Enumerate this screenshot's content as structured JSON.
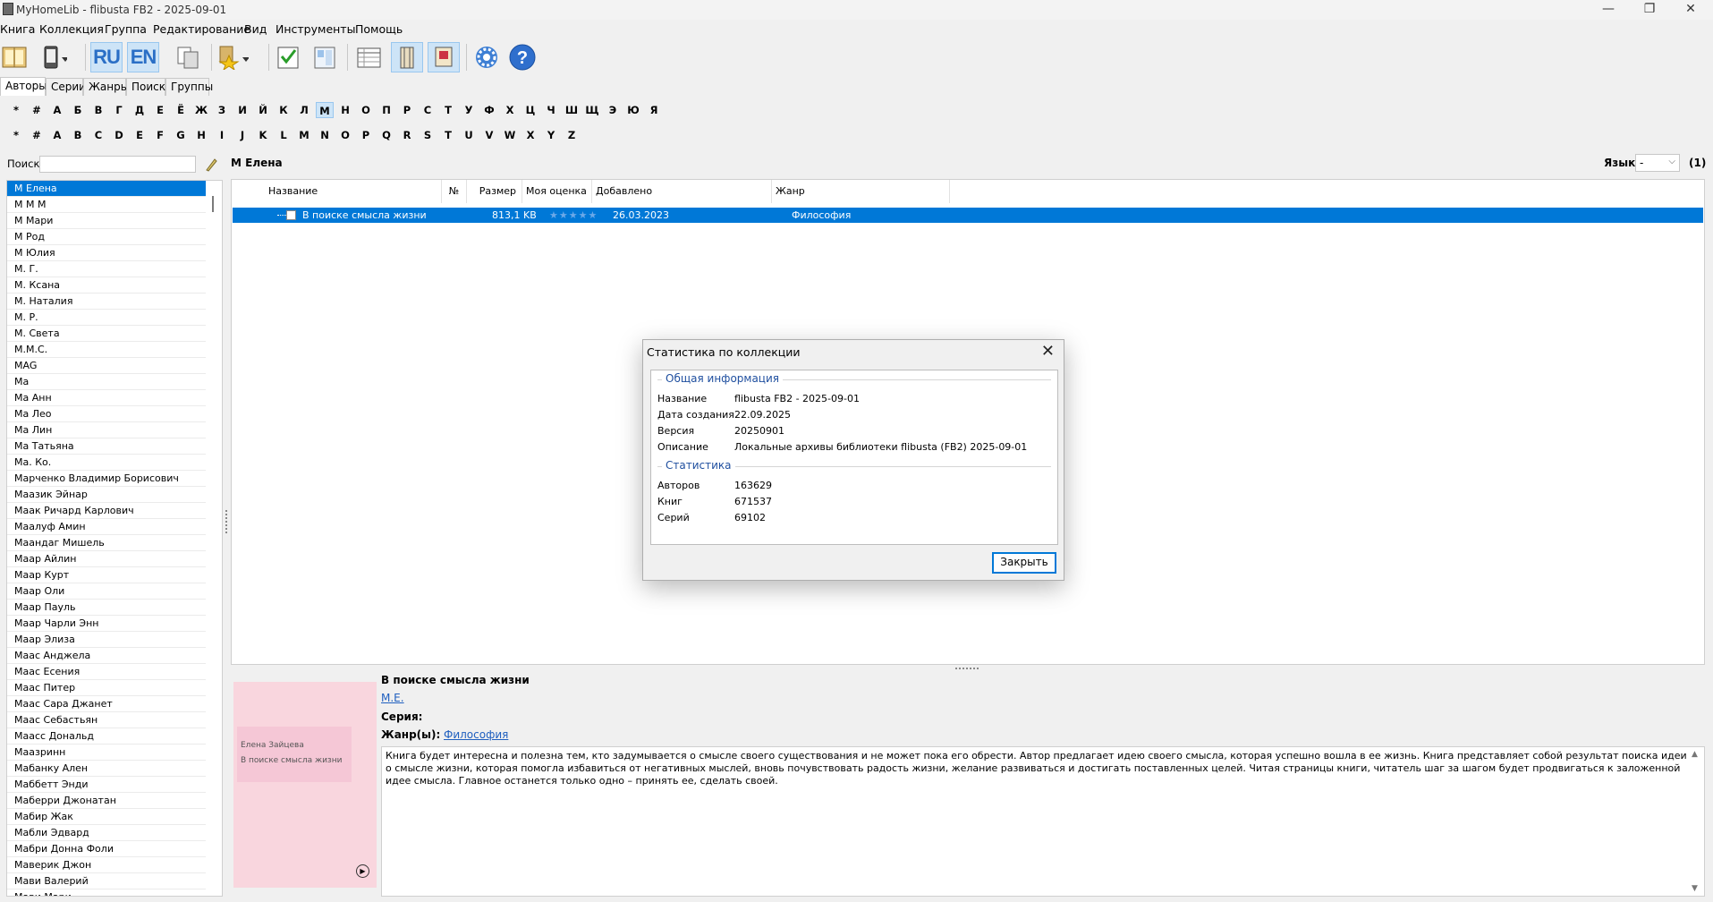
{
  "window": {
    "title": "MyHomeLib - flibusta FB2 - 2025-09-01",
    "minimize": "—",
    "maximize": "❐",
    "close": "✕"
  },
  "menu": [
    "Книга",
    "Коллекция",
    "Группа",
    "Редактирование",
    "Вид",
    "Инструменты",
    "Помощь"
  ],
  "toolbar": {
    "ru": "RU",
    "en": "EN",
    "help": "?"
  },
  "tabs": [
    "Авторы",
    "Серии",
    "Жанры",
    "Поиск",
    "Группы"
  ],
  "alphabet_ru": [
    "*",
    "#",
    "А",
    "Б",
    "В",
    "Г",
    "Д",
    "Е",
    "Ё",
    "Ж",
    "З",
    "И",
    "Й",
    "К",
    "Л",
    "М",
    "Н",
    "О",
    "П",
    "Р",
    "С",
    "Т",
    "У",
    "Ф",
    "Х",
    "Ц",
    "Ч",
    "Ш",
    "Щ",
    "Э",
    "Ю",
    "Я"
  ],
  "alphabet_en": [
    "*",
    "#",
    "A",
    "B",
    "C",
    "D",
    "E",
    "F",
    "G",
    "H",
    "I",
    "J",
    "K",
    "L",
    "M",
    "N",
    "O",
    "P",
    "Q",
    "R",
    "S",
    "T",
    "U",
    "V",
    "W",
    "X",
    "Y",
    "Z"
  ],
  "search": {
    "label": "Поиск",
    "value": ""
  },
  "author_heading": "М Елена",
  "language": {
    "label": "Язык",
    "value": "-",
    "count": "(1)"
  },
  "authors": [
    "М Елена",
    "М М М",
    "М Мари",
    "М Род",
    "М Юлия",
    "М. Г.",
    "М. Ксана",
    "М. Наталия",
    "М. Р.",
    "М. Света",
    "М.М.С.",
    "MAG",
    "Ма",
    "Ма Анн",
    "Ма Лео",
    "Ма Лин",
    "Ма Татьяна",
    "Ма. Ко.",
    "Марченко Владимир Борисович",
    "Маазик Эйнар",
    "Маак Ричард Карлович",
    "Маалуф Амин",
    "Маандаг Мишель",
    "Маар Айлин",
    "Маар Курт",
    "Маар Оли",
    "Маар Пауль",
    "Маар Чарли Энн",
    "Маар Элиза",
    "Маас Анджела",
    "Маас Есения",
    "Маас Питер",
    "Маас Сара Джанет",
    "Маас Себастьян",
    "Маасс Дональд",
    "Маазринн",
    "Мабанку Ален",
    "Маббетт Энди",
    "Маберри Джонатан",
    "Мабир Жак",
    "Мабли Эдвард",
    "Мабри Донна Фоли",
    "Маверик Джон",
    "Мави Валерий",
    "Мави Мари"
  ],
  "table": {
    "columns": [
      "Название",
      "№",
      "Размер",
      "Моя оценка",
      "Добавлено",
      "Жанр"
    ],
    "rows": [
      {
        "title": "В поиске смысла жизни",
        "num": "",
        "size": "813,1 KB",
        "rating": "★★★★★",
        "added": "26.03.2023",
        "genre": "Философия"
      }
    ]
  },
  "details": {
    "title": "В поиске смысла жизни",
    "author": "М.Е.",
    "series_label": "Серия:",
    "genre_label": "Жанр(ы):",
    "genre": "Философия",
    "cover_author": "Елена Зайцева",
    "cover_title": "В поиске смысла жизни",
    "annotation": "Книга будет интересна и полезна тем, кто задумывается о смысле своего существования и не может пока его обрести. Автор предлагает идею своего смысла, которая успешно вошла в ее жизнь. Книга представляет собой результат поиска идеи о смысле жизни, которая помогла избавиться от негативных мыслей, вновь почувствовать радость жизни, желание развиваться и достигать поставленных целей. Читая страницы книги, читатель шаг за шагом будет продвигаться к заложенной идее смысла. Главное останется только одно – принять ее, сделать своей."
  },
  "dialog": {
    "title": "Статистика по коллекции",
    "general_label": "Общая информация",
    "general": [
      {
        "k": "Название",
        "v": "flibusta FB2 - 2025-09-01"
      },
      {
        "k": "Дата создания",
        "v": "22.09.2025"
      },
      {
        "k": "Версия",
        "v": "20250901"
      },
      {
        "k": "Описание",
        "v": "Локальные архивы библиотеки flibusta (FB2) 2025-09-01"
      }
    ],
    "stats_label": "Статистика",
    "stats": [
      {
        "k": "Авторов",
        "v": "163629"
      },
      {
        "k": "Книг",
        "v": "671537"
      },
      {
        "k": "Серий",
        "v": "69102"
      }
    ],
    "close_button": "Закрыть"
  }
}
